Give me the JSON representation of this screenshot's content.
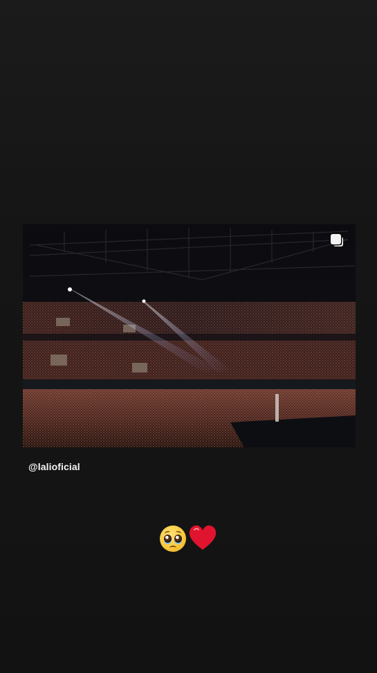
{
  "story": {
    "mention": "@lalioficial",
    "stickers": {
      "first": "pleading-face-emoji",
      "second": "red-heart-emoji"
    }
  },
  "post": {
    "content": "concert-arena-photo",
    "indicator": "multiple-posts-icon"
  },
  "colors": {
    "background": "#141414",
    "text": "#f5f5f5",
    "heart": "#e0142e"
  }
}
